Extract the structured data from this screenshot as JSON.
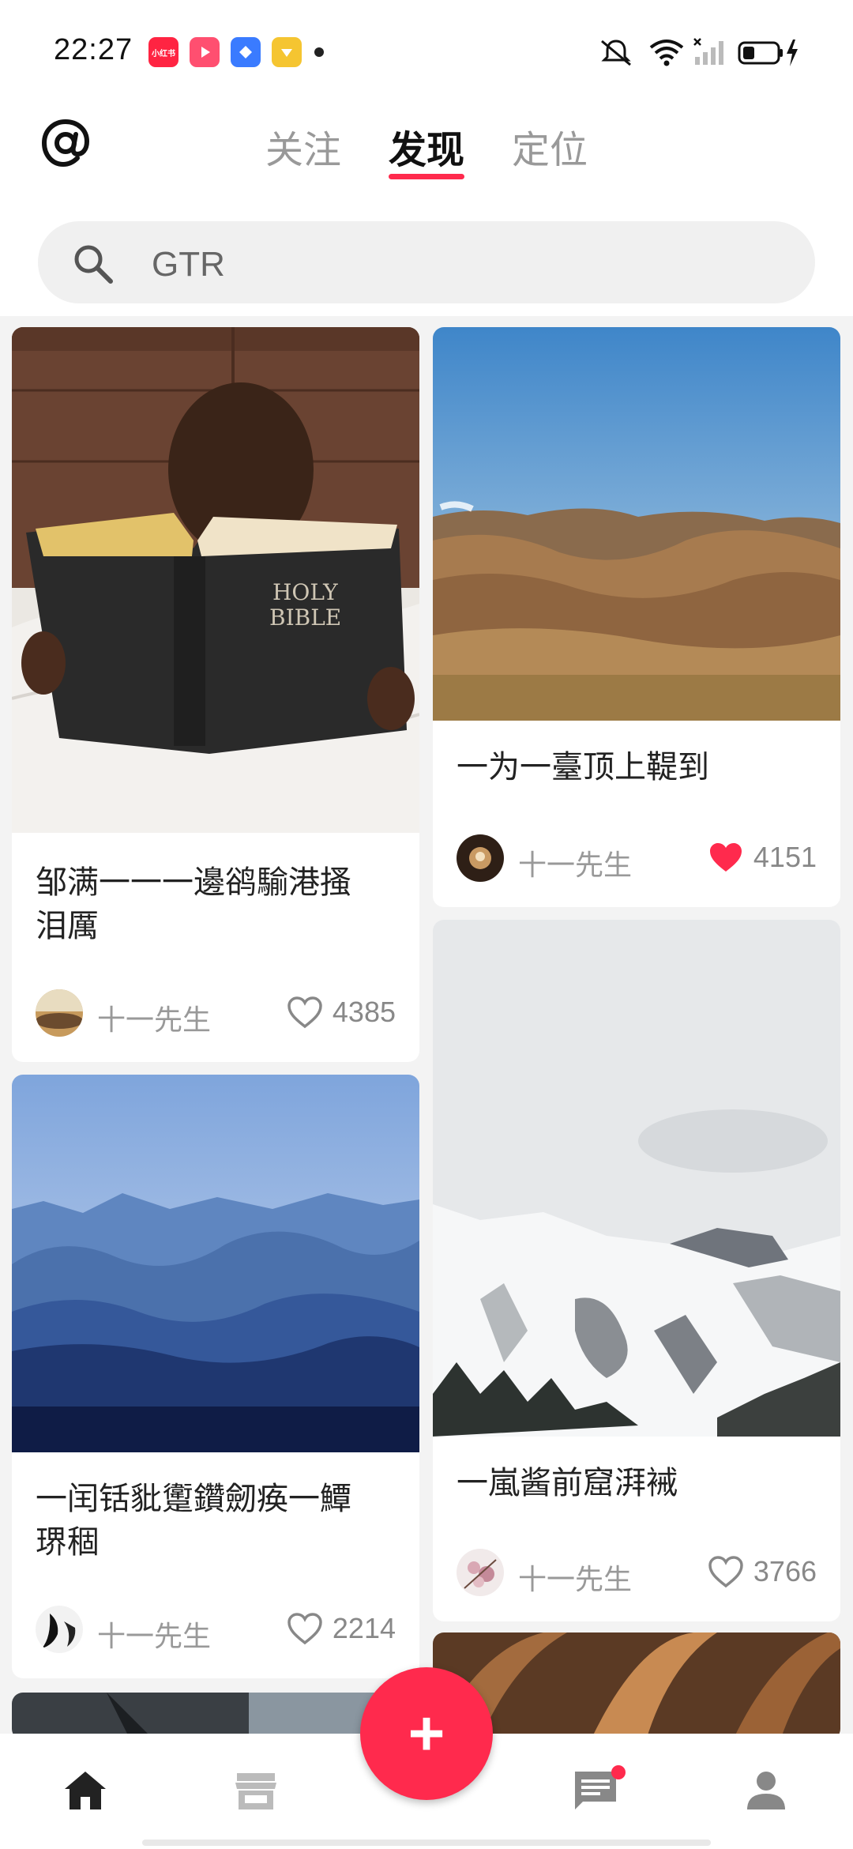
{
  "status_bar": {
    "time": "22:27",
    "apps": [
      {
        "name": "xiaohongshu-app-icon",
        "label": "小红书",
        "color": "#ff2442"
      },
      {
        "name": "play-app-icon",
        "label": "",
        "color": "#ff4f70"
      },
      {
        "name": "blue-app-icon",
        "label": "",
        "color": "#3a7bff"
      },
      {
        "name": "yellow-app-icon",
        "label": "",
        "color": "#f5c531"
      }
    ]
  },
  "header": {
    "tabs": [
      {
        "label": "关注",
        "active": false
      },
      {
        "label": "发现",
        "active": true
      },
      {
        "label": "定位",
        "active": false
      }
    ]
  },
  "search": {
    "text": "GTR"
  },
  "feed": {
    "cards": [
      {
        "title": "邹满一一一邊鹆騟港搔\n泪厲",
        "author": "十一先生",
        "likes": "4385",
        "liked": false
      },
      {
        "title": "一为一臺顶上鞮到",
        "author": "十一先生",
        "likes": "4151",
        "liked": true
      },
      {
        "title": "一闰铦豼躗鑽劒痪一鱏\n琾稒",
        "author": "十一先生",
        "likes": "2214",
        "liked": false
      },
      {
        "title": "一嵐酱前窟湃裓",
        "author": "十一先生",
        "likes": "3766",
        "liked": false
      }
    ]
  },
  "fab": {
    "label": "+"
  },
  "colors": {
    "accent": "#ff2a4d"
  }
}
